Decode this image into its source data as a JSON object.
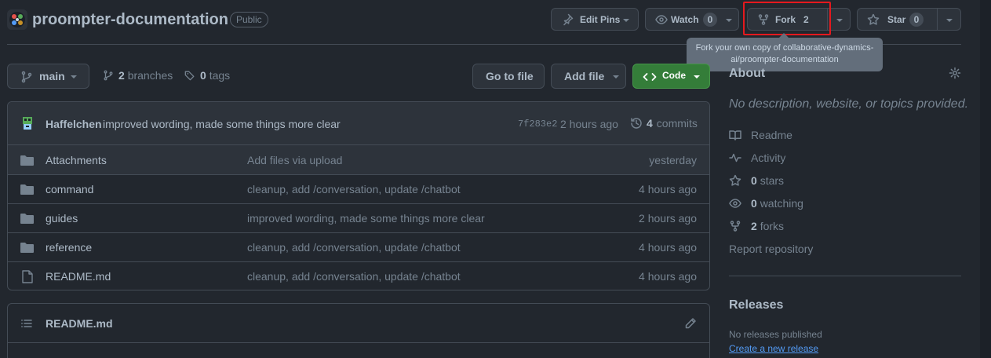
{
  "repo": {
    "name": "proompter-documentation",
    "visibility": "Public"
  },
  "actions": {
    "edit_pins": "Edit Pins",
    "watch": "Watch",
    "watch_count": "0",
    "fork": "Fork",
    "fork_count": "2",
    "star": "Star",
    "star_count": "0"
  },
  "tooltip": {
    "text": "Fork your own copy of collaborative-dynamics-ai/proompter-documentation"
  },
  "toolbar": {
    "branch": "main",
    "branches_count": "2",
    "branches_label": "branches",
    "tags_count": "0",
    "tags_label": "tags",
    "go_to_file": "Go to file",
    "add_file": "Add file",
    "code": "Code"
  },
  "commit": {
    "author": "Haffelchen",
    "message": "improved wording, made some things more clear",
    "sha": "7f283e2",
    "age": "2 hours ago",
    "count": "4",
    "count_label": "commits"
  },
  "files": [
    {
      "name": "Attachments",
      "message": "Add files via upload",
      "age": "yesterday",
      "type": "folder"
    },
    {
      "name": "command",
      "message": "cleanup, add /conversation, update /chatbot",
      "age": "4 hours ago",
      "type": "folder"
    },
    {
      "name": "guides",
      "message": "improved wording, made some things more clear",
      "age": "2 hours ago",
      "type": "folder"
    },
    {
      "name": "reference",
      "message": "cleanup, add /conversation, update /chatbot",
      "age": "4 hours ago",
      "type": "folder"
    },
    {
      "name": "README.md",
      "message": "cleanup, add /conversation, update /chatbot",
      "age": "4 hours ago",
      "type": "file"
    }
  ],
  "readme": {
    "title": "README.md"
  },
  "about": {
    "title": "About",
    "description": "No description, website, or topics provided.",
    "readme": "Readme",
    "activity": "Activity",
    "stars_count": "0",
    "stars_label": "stars",
    "watching_count": "0",
    "watching_label": "watching",
    "forks_count": "2",
    "forks_label": "forks",
    "report": "Report repository"
  },
  "releases": {
    "title": "Releases",
    "none": "No releases published",
    "create": "Create a new release"
  },
  "colors": {
    "background": "#22272e",
    "accent_green": "#347d39",
    "highlight_red": "#e5191e",
    "link_blue": "#539bf5"
  }
}
